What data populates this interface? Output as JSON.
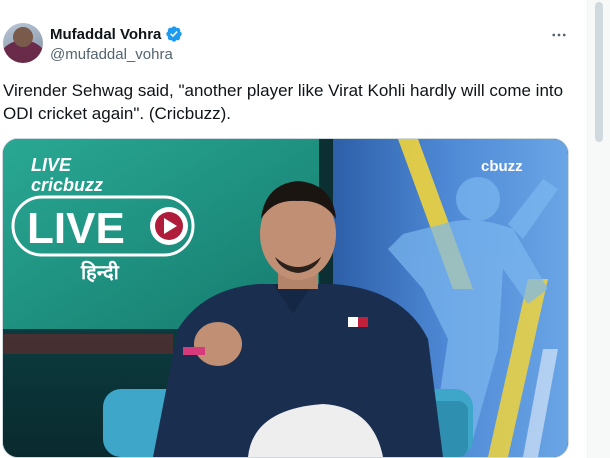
{
  "author": {
    "display_name": "Mufaddal Vohra",
    "handle": "@mufaddal_vohra",
    "verified_icon": "verified-badge-icon",
    "verified_color": "#1d9bf0"
  },
  "tweet": {
    "text": "Virender Sehwag said, \"another player like Virat Kohli hardly will come into ODI cricket again\". (Cricbuzz)."
  },
  "media": {
    "brand_top": "LIVE",
    "brand_sub": "cricbuzz",
    "live_label": "LIVE",
    "hindi_label": "हिन्दी",
    "watermark": "cbuzz",
    "watermark_prefix": "c"
  },
  "colors": {
    "teal_panel": "#1e8f80",
    "accent_yellow": "#f0d33c",
    "blue_wall": "#3f7bc9"
  }
}
